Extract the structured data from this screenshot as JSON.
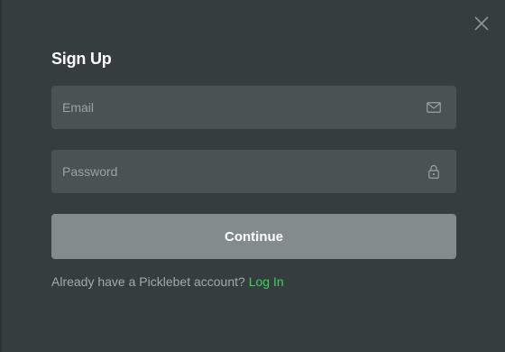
{
  "modal": {
    "title": "Sign Up",
    "close_icon": "close-icon"
  },
  "form": {
    "email": {
      "placeholder": "Email",
      "value": "",
      "icon": "envelope-icon"
    },
    "password": {
      "placeholder": "Password",
      "value": "",
      "icon": "lock-icon"
    },
    "continue_label": "Continue"
  },
  "footer": {
    "prompt": "Already have a Picklebet account?",
    "login_link": "Log In"
  },
  "colors": {
    "background": "#363d3f",
    "field": "#4a5254",
    "button": "#838b8c",
    "link": "#3bd35a"
  }
}
